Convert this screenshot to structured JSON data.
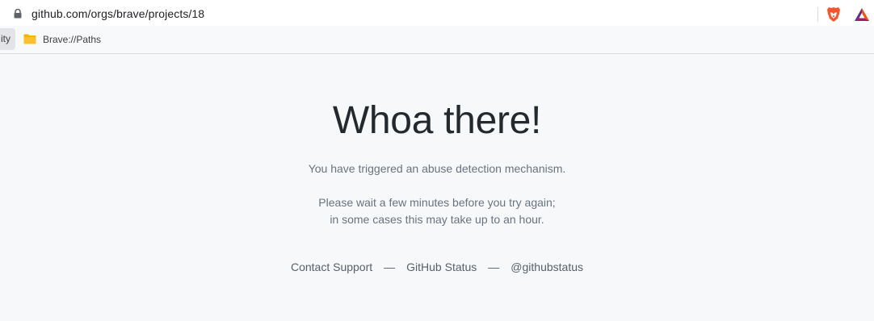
{
  "browser": {
    "url": "github.com/orgs/brave/projects/18",
    "bookmarks": [
      {
        "label": "ity",
        "partial": true
      },
      {
        "label": "Brave://Paths",
        "icon": "folder-icon"
      }
    ],
    "icons": [
      "lock-icon",
      "brave-lion-icon",
      "bat-icon"
    ]
  },
  "page": {
    "title": "Whoa there!",
    "message_1": "You have triggered an abuse detection mechanism.",
    "message_2": "Please wait a few minutes before you try again;",
    "message_3": "in some cases this may take up to an hour.",
    "links": {
      "contact_support": "Contact Support",
      "sep_1": "—",
      "github_status": "GitHub Status",
      "sep_2": "—",
      "twitter": "@githubstatus"
    }
  },
  "colors": {
    "background": "#f6f8fa",
    "title": "#24292e",
    "text": "#6a737d",
    "brave_orange": "#fb542b",
    "bat_purple": "#662d91"
  }
}
